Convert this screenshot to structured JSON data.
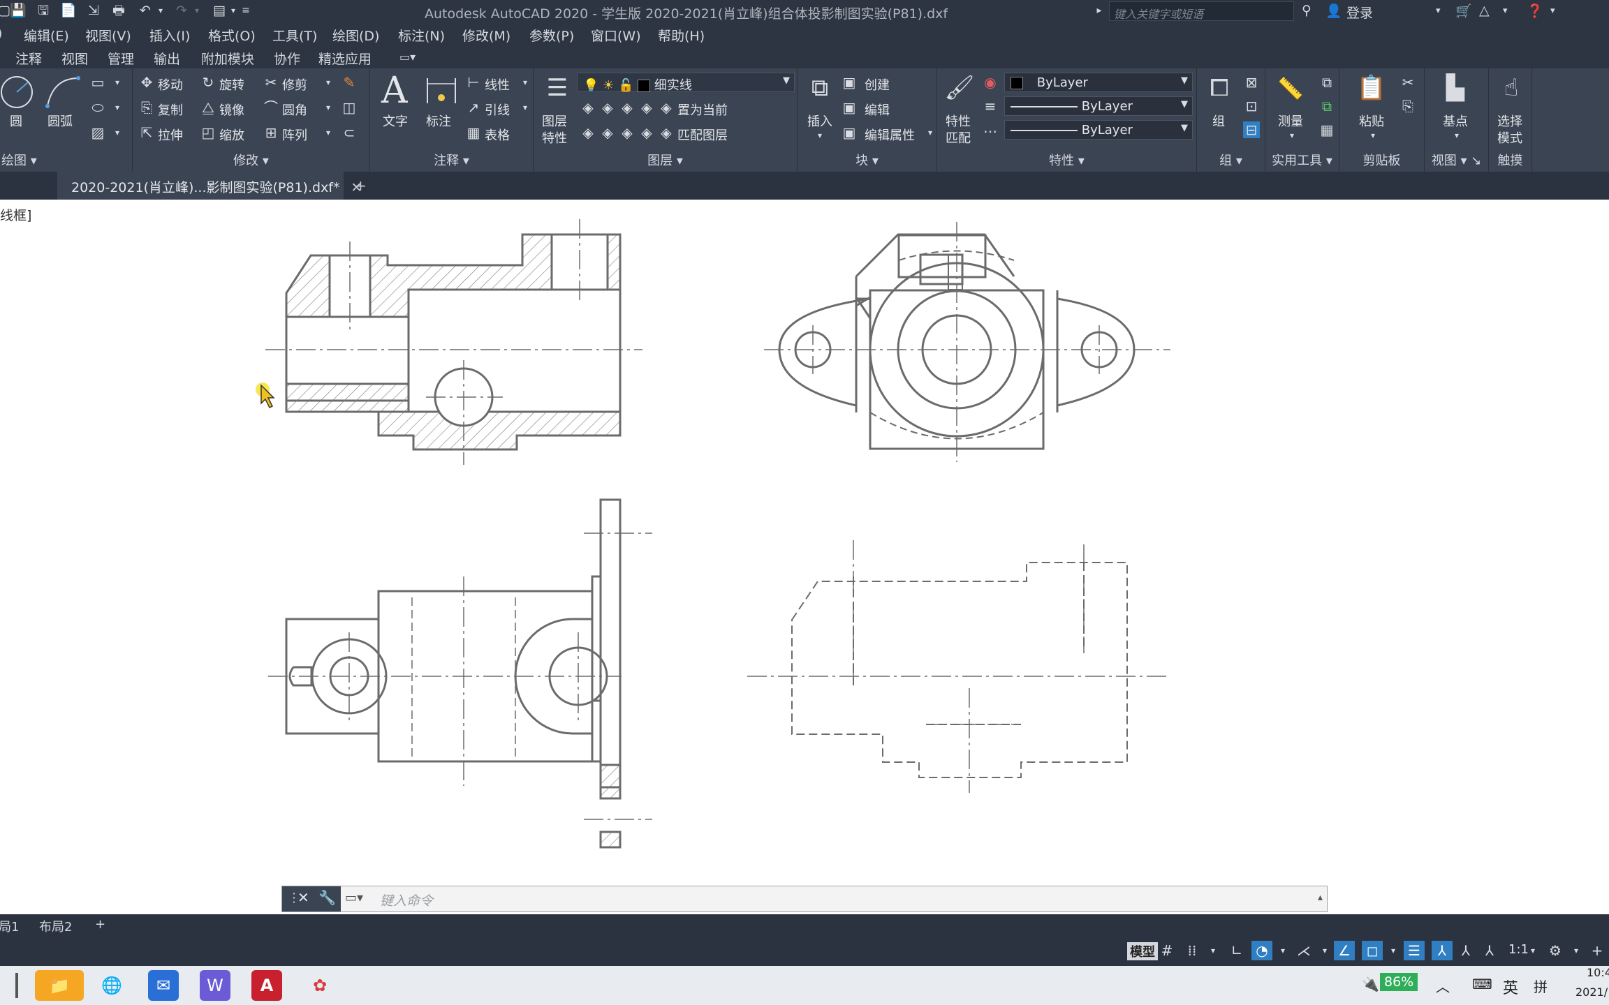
{
  "title_bar": {
    "title": "Autodesk AutoCAD 2020 - 学生版    2020-2021(肖立峰)组合体投影制图实验(P81).dxf",
    "search_placeholder": "键入关键字或短语",
    "login": "登录"
  },
  "menu": {
    "items": [
      "编辑(E)",
      "视图(V)",
      "插入(I)",
      "格式(O)",
      "工具(T)",
      "绘图(D)",
      "标注(N)",
      "修改(M)",
      "参数(P)",
      "窗口(W)",
      "帮助(H)"
    ]
  },
  "ribbon_tabs": [
    "注释",
    "视图",
    "管理",
    "输出",
    "附加模块",
    "协作",
    "精选应用"
  ],
  "ribbon": {
    "draw": {
      "circle": "圆",
      "arc": "圆弧",
      "title": "绘图"
    },
    "modify": {
      "move": "移动",
      "rotate": "旋转",
      "trim": "修剪",
      "copy": "复制",
      "mirror": "镜像",
      "fillet": "圆角",
      "stretch": "拉伸",
      "scale": "缩放",
      "array": "阵列",
      "title": "修改"
    },
    "annotation": {
      "text": "文字",
      "dimension": "标注",
      "linear": "线性",
      "leader": "引线",
      "table": "表格",
      "title": "注释"
    },
    "layers": {
      "layer_props_1": "图层",
      "layer_props_2": "特性",
      "current_layer": "细实线",
      "set_current": "置为当前",
      "match_layer": "匹配图层",
      "title": "图层"
    },
    "block": {
      "insert": "插入",
      "create": "创建",
      "edit": "编辑",
      "edit_attr": "编辑属性",
      "title": "块"
    },
    "properties": {
      "match_1": "特性",
      "match_2": "匹配",
      "color": "ByLayer",
      "linetype": "ByLayer",
      "lineweight": "ByLayer",
      "title": "特性"
    },
    "groups": {
      "group": "组",
      "title": "组"
    },
    "utilities": {
      "measure": "测量",
      "title": "实用工具"
    },
    "clipboard": {
      "paste": "粘贴",
      "title": "剪贴板"
    },
    "view": {
      "base": "基点",
      "title": "视图"
    },
    "touch": {
      "select_1": "选择",
      "select_2": "模式",
      "title": "触摸"
    }
  },
  "doc_tab": {
    "name": "2020-2021(肖立峰)...影制图实验(P81).dxf*"
  },
  "canvas": {
    "viewport_label": "线框]"
  },
  "command": {
    "placeholder": "键入命令"
  },
  "layout_tabs": [
    "局1",
    "布局2"
  ],
  "status": {
    "model": "模型",
    "scale": "1:1"
  },
  "tray": {
    "battery": "86%",
    "ime_lang": "英",
    "ime_mode": "拼",
    "time": "10:4",
    "date": "2021/"
  },
  "colors": {
    "accent": "#2f7fc2",
    "canvas": "#ffffff",
    "chrome": "#2d3542",
    "ribbon": "#3b4453",
    "line": "#6b6b6b"
  }
}
